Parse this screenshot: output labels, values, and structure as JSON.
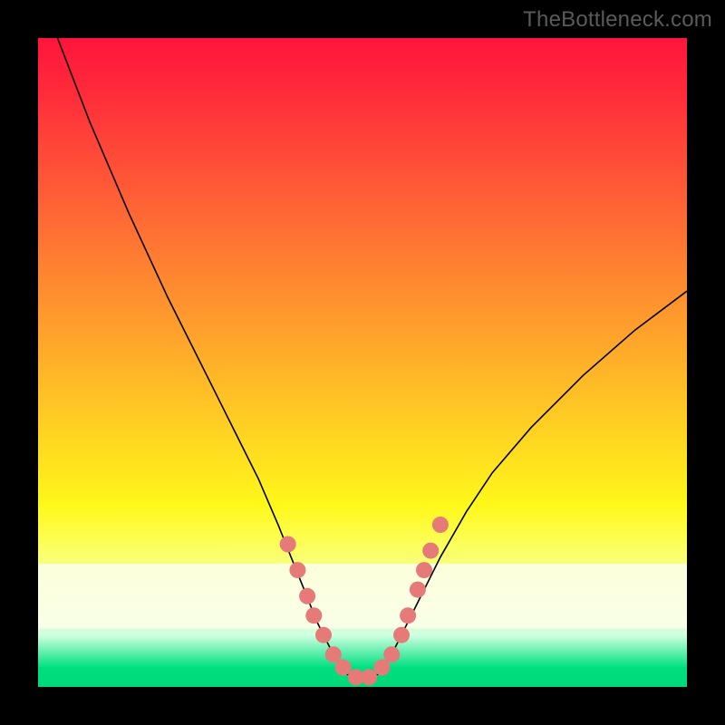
{
  "watermark": "TheBottleneck.com",
  "chart_data": {
    "type": "line",
    "title": "",
    "xlabel": "",
    "ylabel": "",
    "xlim": [
      0,
      100
    ],
    "ylim": [
      0,
      100
    ],
    "background_gradient": {
      "top": "#ff143c",
      "bottom": "#00d878",
      "meaning": "red=high bottleneck, green=low bottleneck"
    },
    "series": [
      {
        "name": "bottleneck-curve",
        "x": [
          3,
          8,
          14,
          20,
          26,
          30,
          34,
          37,
          39,
          41,
          43,
          45,
          47.5,
          50,
          52.5,
          55,
          58,
          62,
          66,
          70,
          76,
          84,
          92,
          100
        ],
        "values": [
          100,
          87,
          73,
          60,
          48,
          40,
          32,
          25,
          20,
          15,
          10,
          6,
          2,
          1,
          2,
          6,
          12,
          20,
          27,
          33,
          40,
          48,
          55,
          61
        ]
      }
    ],
    "markers": {
      "name": "sample-points",
      "x": [
        38.5,
        40,
        41.5,
        42.5,
        44,
        45.5,
        47,
        49,
        51,
        53,
        54.5,
        56,
        57,
        58.5,
        59.5,
        60.5,
        62
      ],
      "values": [
        22,
        18,
        14,
        11,
        8,
        5,
        3,
        1.5,
        1.5,
        3,
        5,
        8,
        11,
        15,
        18,
        21,
        25
      ],
      "color": "#e67a78"
    },
    "annotation_band": {
      "y_range": [
        81,
        91
      ],
      "description": "pale highlight band near bottom of gradient"
    }
  }
}
